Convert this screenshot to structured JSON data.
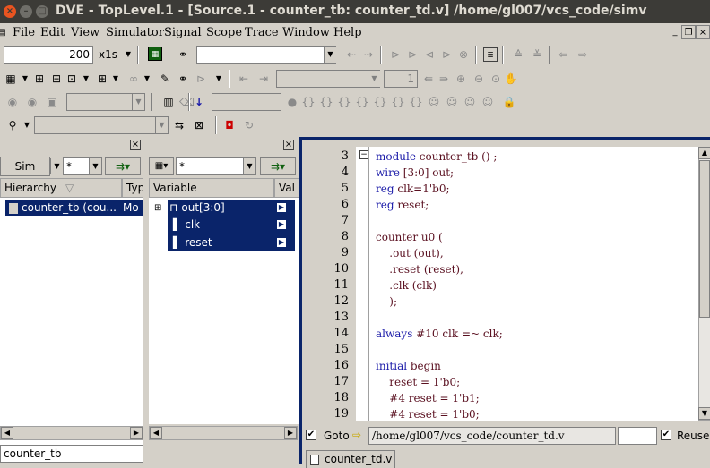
{
  "window": {
    "title": "DVE - TopLevel.1 - [Source.1 - counter_tb: counter_td.v]  /home/gl007/vcs_code/simv"
  },
  "menu": [
    "File",
    "Edit",
    "View",
    "Simulator",
    "Signal",
    "Scope",
    "Trace",
    "Window",
    "Help"
  ],
  "toolbar1": {
    "time_value": "200",
    "time_unit": "x1s",
    "search_value": ""
  },
  "toolbar2": {
    "counter_value": "1"
  },
  "hier_panel": {
    "tab_label": "Sim",
    "filter_value": "*",
    "columns": [
      "Hierarchy",
      "Typ"
    ],
    "rows": [
      {
        "name": "counter_tb (cou...",
        "type": "Mo"
      }
    ],
    "bottom_value": "counter_tb"
  },
  "var_panel": {
    "filter_value": "*",
    "columns": [
      "Variable",
      "Val"
    ],
    "rows": [
      {
        "name": "out[3:0]"
      },
      {
        "name": "clk"
      },
      {
        "name": "reset"
      }
    ]
  },
  "source": {
    "lines": [
      {
        "n": "3",
        "code": "module counter_tb () ;"
      },
      {
        "n": "4",
        "code": "wire [3:0] out;"
      },
      {
        "n": "5",
        "code": "reg clk=1'b0;"
      },
      {
        "n": "6",
        "code": "reg reset;"
      },
      {
        "n": "7",
        "code": ""
      },
      {
        "n": "8",
        "code": "counter u0 ("
      },
      {
        "n": "9",
        "code": "    .out (out),"
      },
      {
        "n": "10",
        "code": "    .reset (reset),"
      },
      {
        "n": "11",
        "code": "    .clk (clk)"
      },
      {
        "n": "12",
        "code": "    );"
      },
      {
        "n": "13",
        "code": ""
      },
      {
        "n": "14",
        "code": "always #10 clk =~ clk;"
      },
      {
        "n": "15",
        "code": ""
      },
      {
        "n": "16",
        "code": "initial begin"
      },
      {
        "n": "17",
        "code": "    reset = 1'b0;"
      },
      {
        "n": "18",
        "code": "    #4 reset = 1'b1;"
      },
      {
        "n": "19",
        "code": "    #4 reset = 1'b0;"
      }
    ],
    "goto_label": "Goto",
    "path": "/home/gl007/vcs_code/counter_td.v",
    "reuse_label": "Reuse",
    "tab_label": "counter_td.v"
  }
}
